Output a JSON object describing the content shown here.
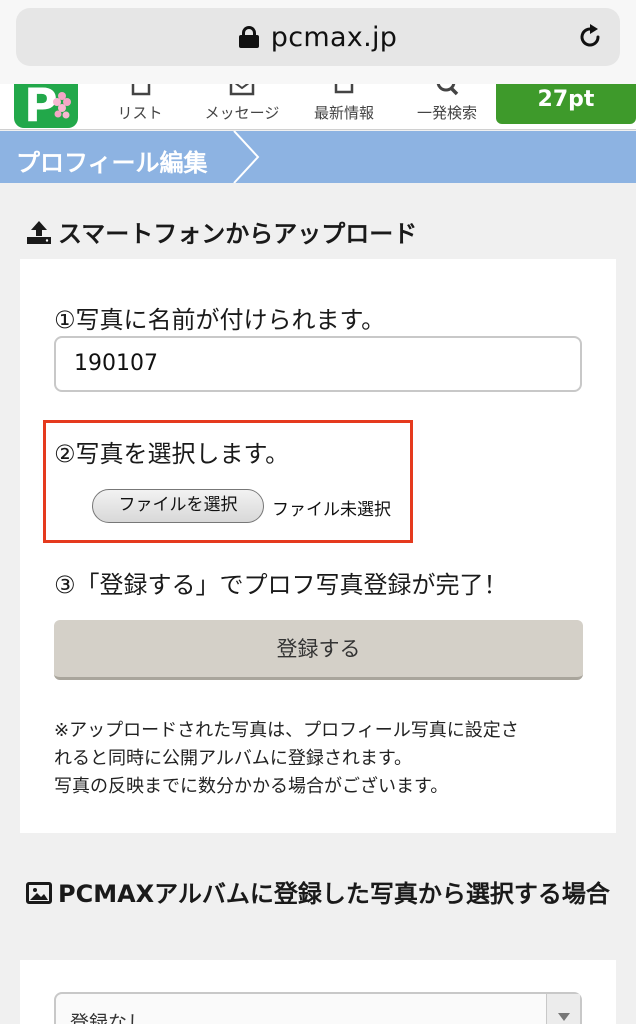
{
  "browser": {
    "url": "pcmax.jp",
    "icons": {
      "lock": "lock-icon",
      "reload": "reload-icon"
    }
  },
  "nav": {
    "items": [
      {
        "label": "リスト",
        "icon": "list-icon"
      },
      {
        "label": "メッセージ",
        "icon": "envelope-icon"
      },
      {
        "label": "最新情報",
        "icon": "news-icon"
      },
      {
        "label": "一発検索",
        "icon": "search-icon"
      }
    ],
    "points": "27pt"
  },
  "header": {
    "title": "プロフィール編集"
  },
  "upload": {
    "title": "スマートフォンからアップロード",
    "step1": "①写真に名前が付けられます。",
    "name_value": "190107",
    "step2": "②写真を選択します。",
    "file_button": "ファイルを選択",
    "file_status": "ファイル未選択",
    "step3": "③「登録する」でプロフ写真登録が完了！",
    "register_button": "登録する",
    "notes": [
      "※アップロードされた写真は、プロフィール写真に設定さ",
      "れると同時に公開アルバムに登録されます。",
      "写真の反映までに数分かかる場合がございます。"
    ]
  },
  "album": {
    "title": "PCMAXアルバムに登録した写真から選択する場合",
    "select_value": "登録なし"
  },
  "colors": {
    "header_bg": "#8db3e2",
    "points_bg": "#3e9a2b",
    "highlight": "#e53a1e",
    "register_bg": "#d4d0c8"
  }
}
